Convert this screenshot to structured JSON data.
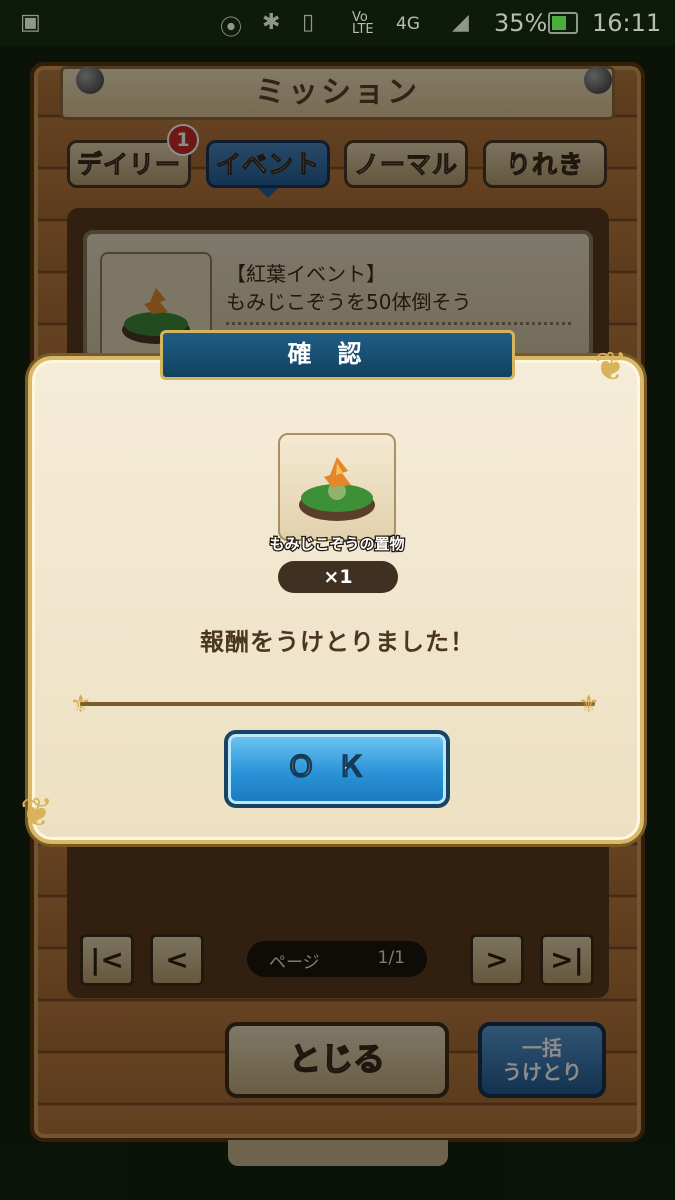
{
  "status_bar": {
    "battery": "35%",
    "time": "16:11",
    "network": "4G",
    "volte": "Vo LTE"
  },
  "screen_title": "ミッション",
  "tabs": [
    {
      "label": "デイリー",
      "badge": "1"
    },
    {
      "label": "イベント"
    },
    {
      "label": "ノーマル"
    },
    {
      "label": "りれき"
    }
  ],
  "mission": {
    "title": "【紅葉イベント】",
    "description": "もみじこぞうを50体倒そう"
  },
  "pagination": {
    "label": "ページ",
    "value": "1/1",
    "first": "|<",
    "prev": "<",
    "next": ">",
    "last": ">|"
  },
  "buttons": {
    "close": "とじる",
    "claim_all_line1": "一括",
    "claim_all_line2": "うけとり"
  },
  "dialog": {
    "title": "確認",
    "reward_name": "もみじこぞうの置物",
    "reward_count": "×1",
    "message": "報酬をうけとりました！",
    "ok": "ＯＫ"
  },
  "colors": {
    "wood": "#b77a3f",
    "dialog_bg": "#f2e7cf",
    "dialog_header": "#1a5478",
    "ok_button": "#2a93d8",
    "active_tab": "#3572ab",
    "badge": "#c72c22"
  }
}
